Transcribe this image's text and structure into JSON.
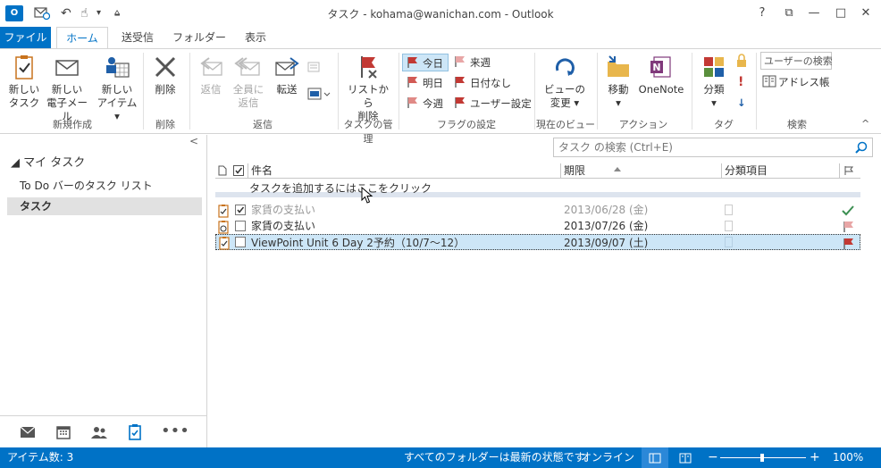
{
  "window": {
    "title": "タスク - kohama@wanichan.com - Outlook",
    "app_icon": "O",
    "help": "?",
    "restore_ribbon": "⧉",
    "minimize": "—",
    "maximize": "□",
    "close": "✕"
  },
  "qat": {
    "sendrecv_icon": "envelope-sync-icon",
    "undo": "↶",
    "touch": "☝",
    "more": "▾",
    "customize": "⩠"
  },
  "tabs": [
    {
      "label": "ファイル"
    },
    {
      "label": "ホーム"
    },
    {
      "label": "送受信"
    },
    {
      "label": "フォルダー"
    },
    {
      "label": "表示"
    }
  ],
  "ribbon": {
    "groups": {
      "new": "新規作成",
      "delete": "削除",
      "respond": "返信",
      "manage": "タスクの管理",
      "flags": "フラグの設定",
      "view": "現在のビュー",
      "actions": "アクション",
      "tags": "タグ",
      "find": "検索"
    },
    "new_task": [
      "新しい",
      "タスク"
    ],
    "new_email": [
      "新しい",
      "電子メール"
    ],
    "new_items": [
      "新しい",
      "アイテム ▾"
    ],
    "delete": "削除",
    "reply": "返信",
    "reply_all": [
      "全員に",
      "返信"
    ],
    "forward": "転送",
    "remove_list": [
      "リストから",
      "削除"
    ],
    "flags": {
      "today": "今日",
      "tomorrow": "明日",
      "this_week": "今週",
      "next_week": "来週",
      "no_date": "日付なし",
      "custom": "ユーザー設定"
    },
    "change_view": [
      "ビューの",
      "変更 ▾"
    ],
    "move": [
      "移動",
      "▾"
    ],
    "onenote": "OneNote",
    "categorize": [
      "分類",
      "▾"
    ],
    "search_people": "ユーザーの検索",
    "address_book": "アドレス帳",
    "collapse": "^"
  },
  "nav": {
    "collapse": "<",
    "header": "◢ マイ タスク",
    "items": [
      {
        "label": "To Do バーのタスク リスト"
      },
      {
        "label": "タスク"
      }
    ]
  },
  "main": {
    "search_placeholder": "タスク の検索 (Ctrl+E)",
    "columns": {
      "subject": "件名",
      "due": "期限",
      "category": "分類項目"
    },
    "add_task": "タスクを追加するにはここをクリック",
    "rows": [
      {
        "subject": "家賃の支払い",
        "due": "2013/06/28 (金)",
        "done": true
      },
      {
        "subject": "家賃の支払い",
        "due": "2013/07/26 (金)",
        "done": false
      },
      {
        "subject": "ViewPoint Unit 6 Day 2予約（10/7～12）",
        "due": "2013/09/07 (土)",
        "done": false
      }
    ]
  },
  "status": {
    "items_count": "アイテム数: 3",
    "folders": "すべてのフォルダーは最新の状態です。",
    "online": "オンライン",
    "zoom": "100%",
    "zoom_minus": "−",
    "zoom_plus": "+"
  },
  "colors": {
    "accent": "#0072c6",
    "flag_red": "#c23934",
    "flag_pink": "#e8a6a6"
  }
}
